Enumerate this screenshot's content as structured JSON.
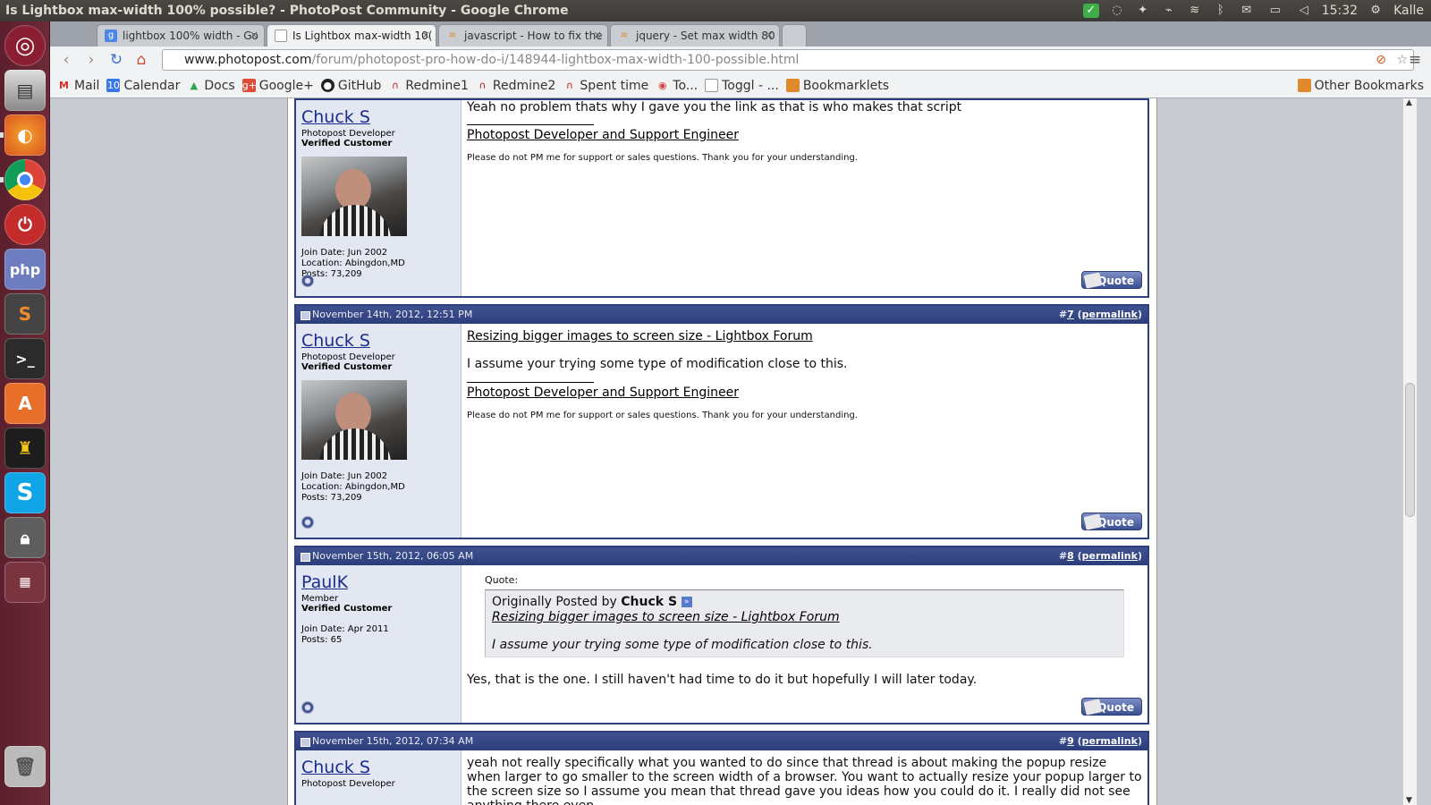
{
  "window": {
    "title": "Is Lightbox max-width 100% possible? - PhotoPost Community - Google Chrome"
  },
  "indicators": {
    "time": "15:32",
    "user": "Kalle"
  },
  "tabs": [
    {
      "label": "lightbox 100% width - Go",
      "icon": "google-icon"
    },
    {
      "label": "Is Lightbox max-width 10(",
      "icon": "page-icon"
    },
    {
      "label": "javascript - How to fix the",
      "icon": "stackoverflow-icon"
    },
    {
      "label": "jquery - Set max width 80",
      "icon": "stackoverflow-icon"
    }
  ],
  "address": {
    "host": "www.photopost.com",
    "path": "/forum/photopost-pro-how-do-i/148944-lightbox-max-width-100-possible.html"
  },
  "bookmarks": [
    {
      "label": "Mail",
      "icon": "gmail-icon",
      "color": "#d93025"
    },
    {
      "label": "Calendar",
      "icon": "calendar-icon",
      "color": "#3b78e7"
    },
    {
      "label": "Docs",
      "icon": "drive-icon",
      "color": "#2da44e"
    },
    {
      "label": "Google+",
      "icon": "googleplus-icon",
      "color": "#dd4b39"
    },
    {
      "label": "GitHub",
      "icon": "github-icon",
      "color": "#222222"
    },
    {
      "label": "Redmine1",
      "icon": "redmine-icon",
      "color": "#b32024"
    },
    {
      "label": "Redmine2",
      "icon": "redmine-icon",
      "color": "#b32024"
    },
    {
      "label": "Spent time",
      "icon": "redmine-icon",
      "color": "#b32024"
    },
    {
      "label": "To...",
      "icon": "todoist-icon",
      "color": "#d1453b"
    },
    {
      "label": "Toggl - ...",
      "icon": "page-icon",
      "color": "#999999"
    },
    {
      "label": "Bookmarklets",
      "icon": "folder-icon",
      "color": "#e08a2c"
    }
  ],
  "other_bookmarks": "Other Bookmarks",
  "posts": [
    {
      "date": "",
      "num": "",
      "user": "Chuck S",
      "role": "Photopost Developer",
      "status": "Verified Customer",
      "join": "Join Date: Jun 2002",
      "location": "Location: Abingdon,MD",
      "posts": "Posts: 73,209",
      "line1": "Yeah no problem thats why I gave you the link as that is who makes that script",
      "sig": "Photopost Developer and Support Engineer",
      "note": "Please do not PM me for support or sales questions. Thank you for your understanding.",
      "quote": "Quote"
    },
    {
      "date": "November 14th, 2012, 12:51 PM",
      "num": "7",
      "permalink": "permalink",
      "user": "Chuck S",
      "role": "Photopost Developer",
      "status": "Verified Customer",
      "join": "Join Date: Jun 2002",
      "location": "Location: Abingdon,MD",
      "posts": "Posts: 73,209",
      "link": "Resizing bigger images to screen size - Lightbox Forum",
      "line1": "I assume your trying some type of modification close to this.",
      "sig": "Photopost Developer and Support Engineer",
      "note": "Please do not PM me for support or sales questions. Thank you for your understanding.",
      "quote": "Quote"
    },
    {
      "date": "November 15th, 2012, 06:05 AM",
      "num": "8",
      "permalink": "permalink",
      "user": "PaulK",
      "role": "Member",
      "status": "Verified Customer",
      "join": "Join Date: Apr 2011",
      "posts": "Posts: 65",
      "quote_label": "Quote:",
      "quote_author_prefix": "Originally Posted by",
      "quote_author": "Chuck S",
      "quote_link": "Resizing bigger images to screen size - Lightbox Forum",
      "quote_text": "I assume your trying some type of modification close to this.",
      "reply": "Yes, that is the one. I still haven't had time to do it but hopefully I will later today.",
      "quote": "Quote"
    },
    {
      "date": "November 15th, 2012, 07:34 AM",
      "num": "9",
      "permalink": "permalink",
      "user": "Chuck S",
      "role": "Photopost Developer",
      "text": "yeah not really specifically what you wanted to do since that thread is about making the popup resize when larger to go smaller to the screen width of a browser. You want to actually resize your popup larger to the screen size so I assume you mean that thread gave you ideas how you could do it. I really did not see anything there even"
    }
  ]
}
